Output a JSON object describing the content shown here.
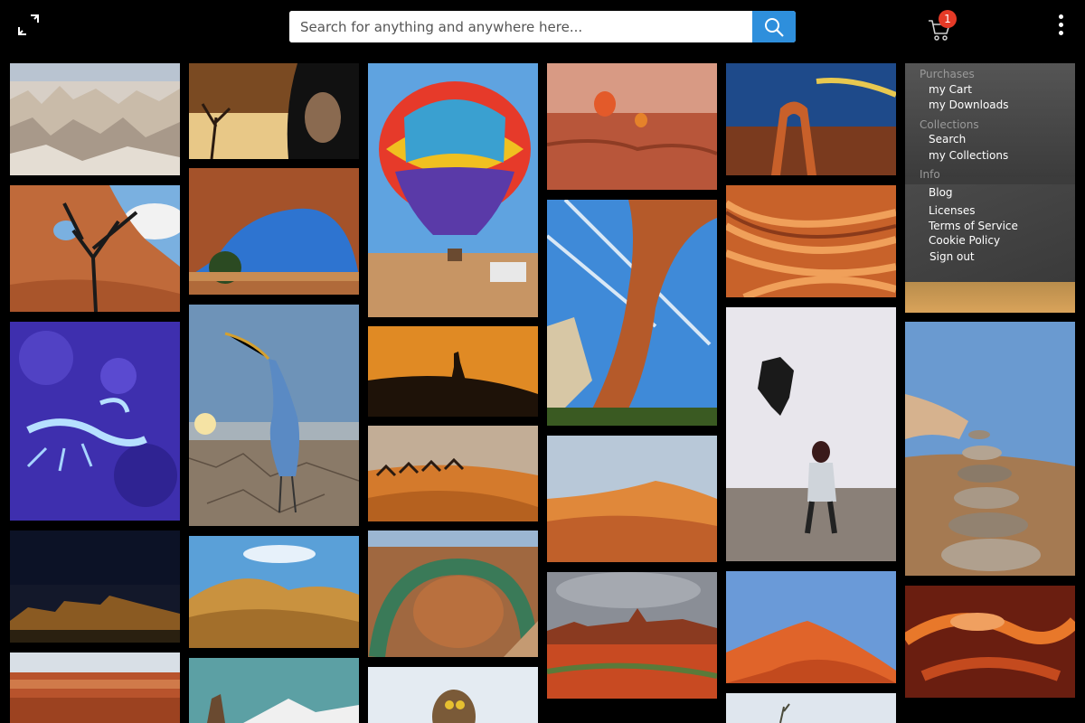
{
  "header": {
    "expand_icon": "expand-icon",
    "search": {
      "placeholder": "Search for anything and anywhere here...",
      "value": "",
      "button_icon": "search-icon"
    },
    "cart": {
      "icon": "cart-icon",
      "badge_count": "1"
    },
    "more_icon": "kebab-menu-icon"
  },
  "menu": {
    "sections": [
      {
        "title": "Purchases",
        "items": [
          "my Cart",
          "my Downloads"
        ]
      },
      {
        "title": "Collections",
        "items": [
          "Search",
          "my Collections"
        ]
      },
      {
        "title": "Info",
        "items": [
          "Blog",
          "Licenses",
          "Terms of Service",
          "Cookie Policy",
          "Sign out"
        ]
      }
    ]
  },
  "gallery": {
    "photos": [
      "badlands-hoodoos-photo",
      "desert-tree-arch-photo",
      "glowing-scorpion-photo",
      "night-canyon-photo",
      "red-rock-canyon-photo",
      "old-woman-desert-photo",
      "natural-arch-photo",
      "heron-dry-ground-photo",
      "sand-dunes-photo",
      "snow-mountain-rock-photo",
      "hot-air-balloon-photo",
      "camel-silhouette-photo",
      "camel-caravan-photo",
      "horseshoe-bend-photo",
      "owl-photo",
      "balloons-over-desert-photo",
      "rock-arch-sky-photo",
      "orange-dunes-photo",
      "monument-valley-photo",
      "delicate-arch-photo",
      "wave-sandstone-photo",
      "woman-throwing-cloth-photo",
      "red-dune-people-photo",
      "desert-plant-photo",
      "stone-cairn-photo",
      "antelope-canyon-photo"
    ]
  },
  "colors": {
    "background": "#000000",
    "search_button": "#2e8fdc",
    "badge": "#e53a27",
    "menu_section": "#9a9a9a",
    "menu_item": "#ffffff"
  }
}
